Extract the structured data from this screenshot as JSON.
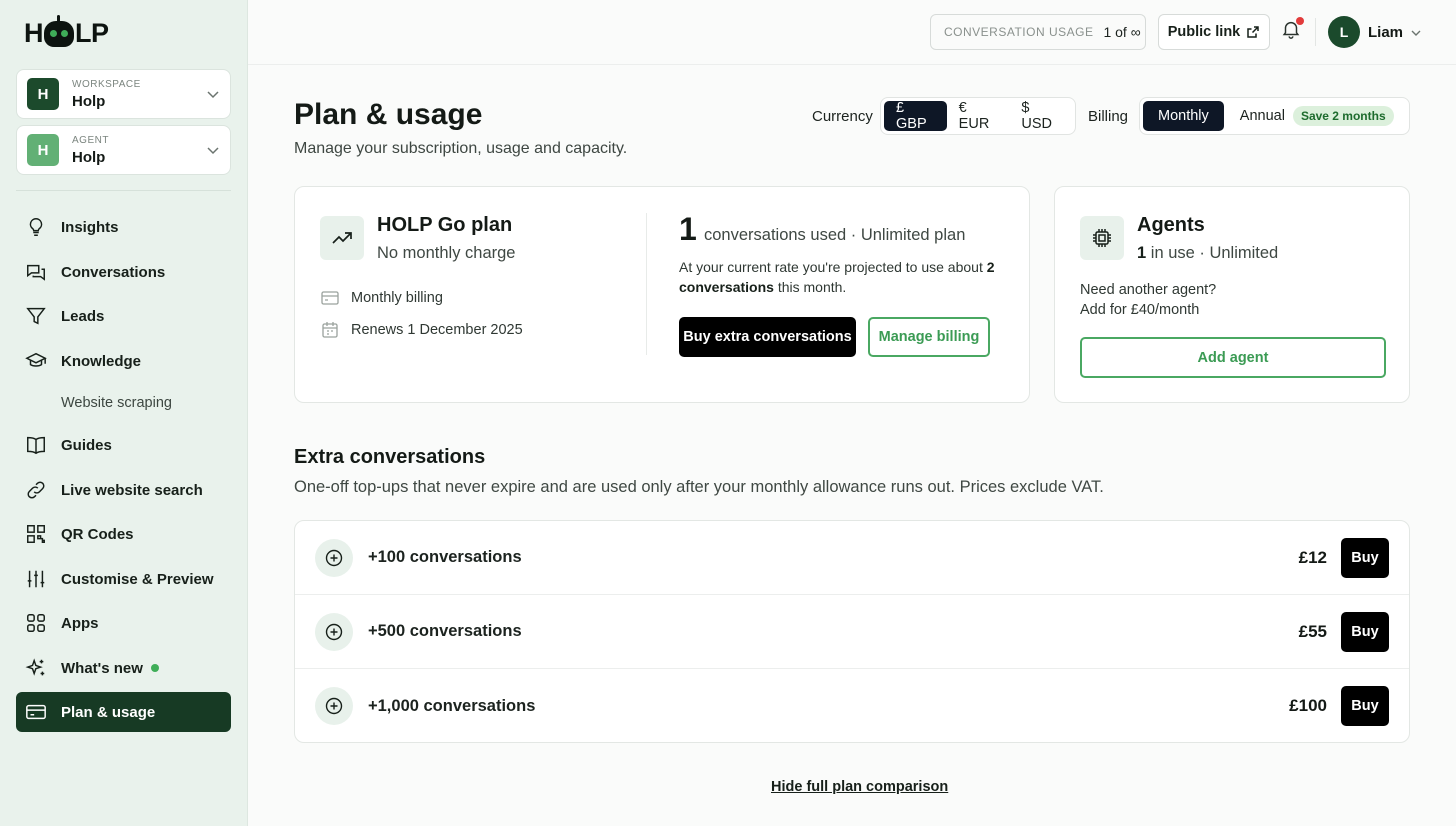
{
  "brand": {
    "logo_left": "H",
    "logo_right": "LP"
  },
  "workspace": {
    "caption": "WORKSPACE",
    "initial": "H",
    "name": "Holp"
  },
  "agent": {
    "caption": "AGENT",
    "initial": "H",
    "name": "Holp"
  },
  "nav": {
    "insights": "Insights",
    "conversations": "Conversations",
    "leads": "Leads",
    "knowledge": "Knowledge",
    "website_scraping": "Website scraping",
    "guides": "Guides",
    "live_search": "Live website search",
    "qr_codes": "QR Codes",
    "customise": "Customise & Preview",
    "apps": "Apps",
    "whats_new": "What's new",
    "plan_usage": "Plan & usage"
  },
  "topbar": {
    "usage_label": "CONVERSATION USAGE",
    "usage_value": "1 of ∞",
    "public_link": "Public link",
    "user_initial": "L",
    "user_name": "Liam"
  },
  "page": {
    "title": "Plan & usage",
    "subtitle": "Manage your subscription, usage and capacity."
  },
  "currency": {
    "label": "Currency",
    "options": [
      "£ GBP",
      "€ EUR",
      "$ USD"
    ],
    "selected": "£ GBP"
  },
  "billing": {
    "label": "Billing",
    "options": [
      "Monthly",
      "Annual"
    ],
    "selected": "Monthly",
    "save_badge": "Save 2 months"
  },
  "plan_card": {
    "title": "HOLP Go plan",
    "subtitle": "No monthly charge",
    "billing_cycle": "Monthly billing",
    "renews": "Renews 1 December 2025",
    "used_count": "1",
    "used_text": "conversations used · Unlimited plan",
    "projection_pre": "At your current rate you're projected to use about ",
    "projection_bold": "2 conversations",
    "projection_post": " this month.",
    "buy_extra": "Buy extra conversations",
    "manage_billing": "Manage billing"
  },
  "agents_card": {
    "title": "Agents",
    "count": "1",
    "status": " in use · Unlimited",
    "need_another": "Need another agent?",
    "add_price": "Add for £40/month",
    "add_button": "Add agent"
  },
  "extra": {
    "title": "Extra conversations",
    "subtitle": "One-off top-ups that never expire and are used only after your monthly allowance runs out. Prices exclude VAT.",
    "packs": [
      {
        "name": "+100 conversations",
        "price": "£12",
        "buy": "Buy"
      },
      {
        "name": "+500 conversations",
        "price": "£55",
        "buy": "Buy"
      },
      {
        "name": "+1,000 conversations",
        "price": "£100",
        "buy": "Buy"
      }
    ]
  },
  "hide_comparison": "Hide full plan comparison",
  "icons": {
    "insights": "lightbulb-icon",
    "conversations": "chat-bubbles-icon",
    "leads": "funnel-icon",
    "knowledge": "graduation-cap-icon",
    "guides": "book-icon",
    "live_search": "link-icon",
    "qr": "qr-code-icon",
    "customise": "sliders-icon",
    "apps": "grid-icon",
    "whats_new": "sparkles-icon",
    "plan": "credit-card-icon"
  },
  "colors": {
    "brand_dark": "#173a24",
    "accent_green": "#4aa862",
    "notification": "#e23b3b"
  }
}
